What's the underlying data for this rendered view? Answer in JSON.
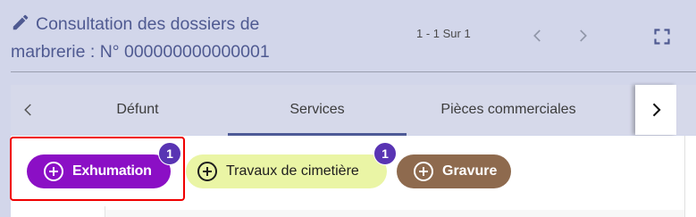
{
  "header": {
    "title": "Consultation des dossiers de marbrerie : N° 000000000000001",
    "edit_icon": "pencil-icon"
  },
  "pager": {
    "text": "1 - 1 Sur 1",
    "prev_icon": "chevron-left-icon",
    "next_icon": "chevron-right-icon",
    "fullscreen_icon": "fullscreen-icon"
  },
  "tabs": {
    "items": [
      {
        "label": "Défunt"
      },
      {
        "label": "Services",
        "active": true
      },
      {
        "label": "Pièces commerciales"
      }
    ],
    "scroll_left_icon": "chevron-left-icon",
    "scroll_right_icon": "chevron-right-icon"
  },
  "services": [
    {
      "label": "Exhumation",
      "badge": "1",
      "color": "#8b0fc5",
      "text_color": "#ffffff",
      "highlighted": true
    },
    {
      "label": "Travaux de cimetière",
      "badge": "1",
      "color": "#eaf5a5",
      "text_color": "#1e1e1e"
    },
    {
      "label": "Gravure",
      "badge": "",
      "color": "#8e6a4e",
      "text_color": "#ffffff"
    }
  ],
  "colors": {
    "background": "#d2d6ea",
    "title": "#4f5a91",
    "tab_indicator": "#4e5a96",
    "badge": "#5934b3",
    "highlight": "#f00000"
  }
}
